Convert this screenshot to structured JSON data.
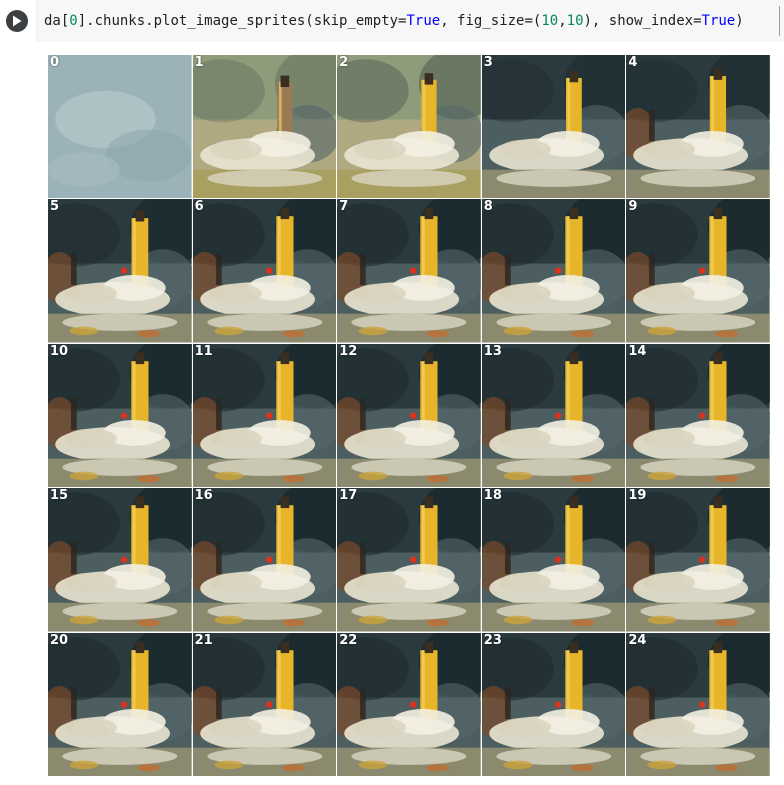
{
  "cell": {
    "run_icon": "play-icon",
    "code": {
      "prefix": "da[",
      "index": "0",
      "middle": "].chunks.plot_image_sprites(skip_empty=",
      "skip_empty_value": "True",
      "fig_size_label": ", fig_size=(",
      "fig_w": "10",
      "comma": ",",
      "fig_h": "10",
      "show_index_label": "), show_index=",
      "show_index_value": "True",
      "suffix": ")"
    }
  },
  "output": {
    "sprites": [
      {
        "index": "0"
      },
      {
        "index": "1"
      },
      {
        "index": "2"
      },
      {
        "index": "3"
      },
      {
        "index": "4"
      },
      {
        "index": "5"
      },
      {
        "index": "6"
      },
      {
        "index": "7"
      },
      {
        "index": "8"
      },
      {
        "index": "9"
      },
      {
        "index": "10"
      },
      {
        "index": "11"
      },
      {
        "index": "12"
      },
      {
        "index": "13"
      },
      {
        "index": "14"
      },
      {
        "index": "15"
      },
      {
        "index": "16"
      },
      {
        "index": "17"
      },
      {
        "index": "18"
      },
      {
        "index": "19"
      },
      {
        "index": "20"
      },
      {
        "index": "21"
      },
      {
        "index": "22"
      },
      {
        "index": "23"
      },
      {
        "index": "24"
      }
    ]
  },
  "colors": {
    "keyword": "#0000ff",
    "number": "#098658",
    "code_bg": "#f7f7f7"
  }
}
